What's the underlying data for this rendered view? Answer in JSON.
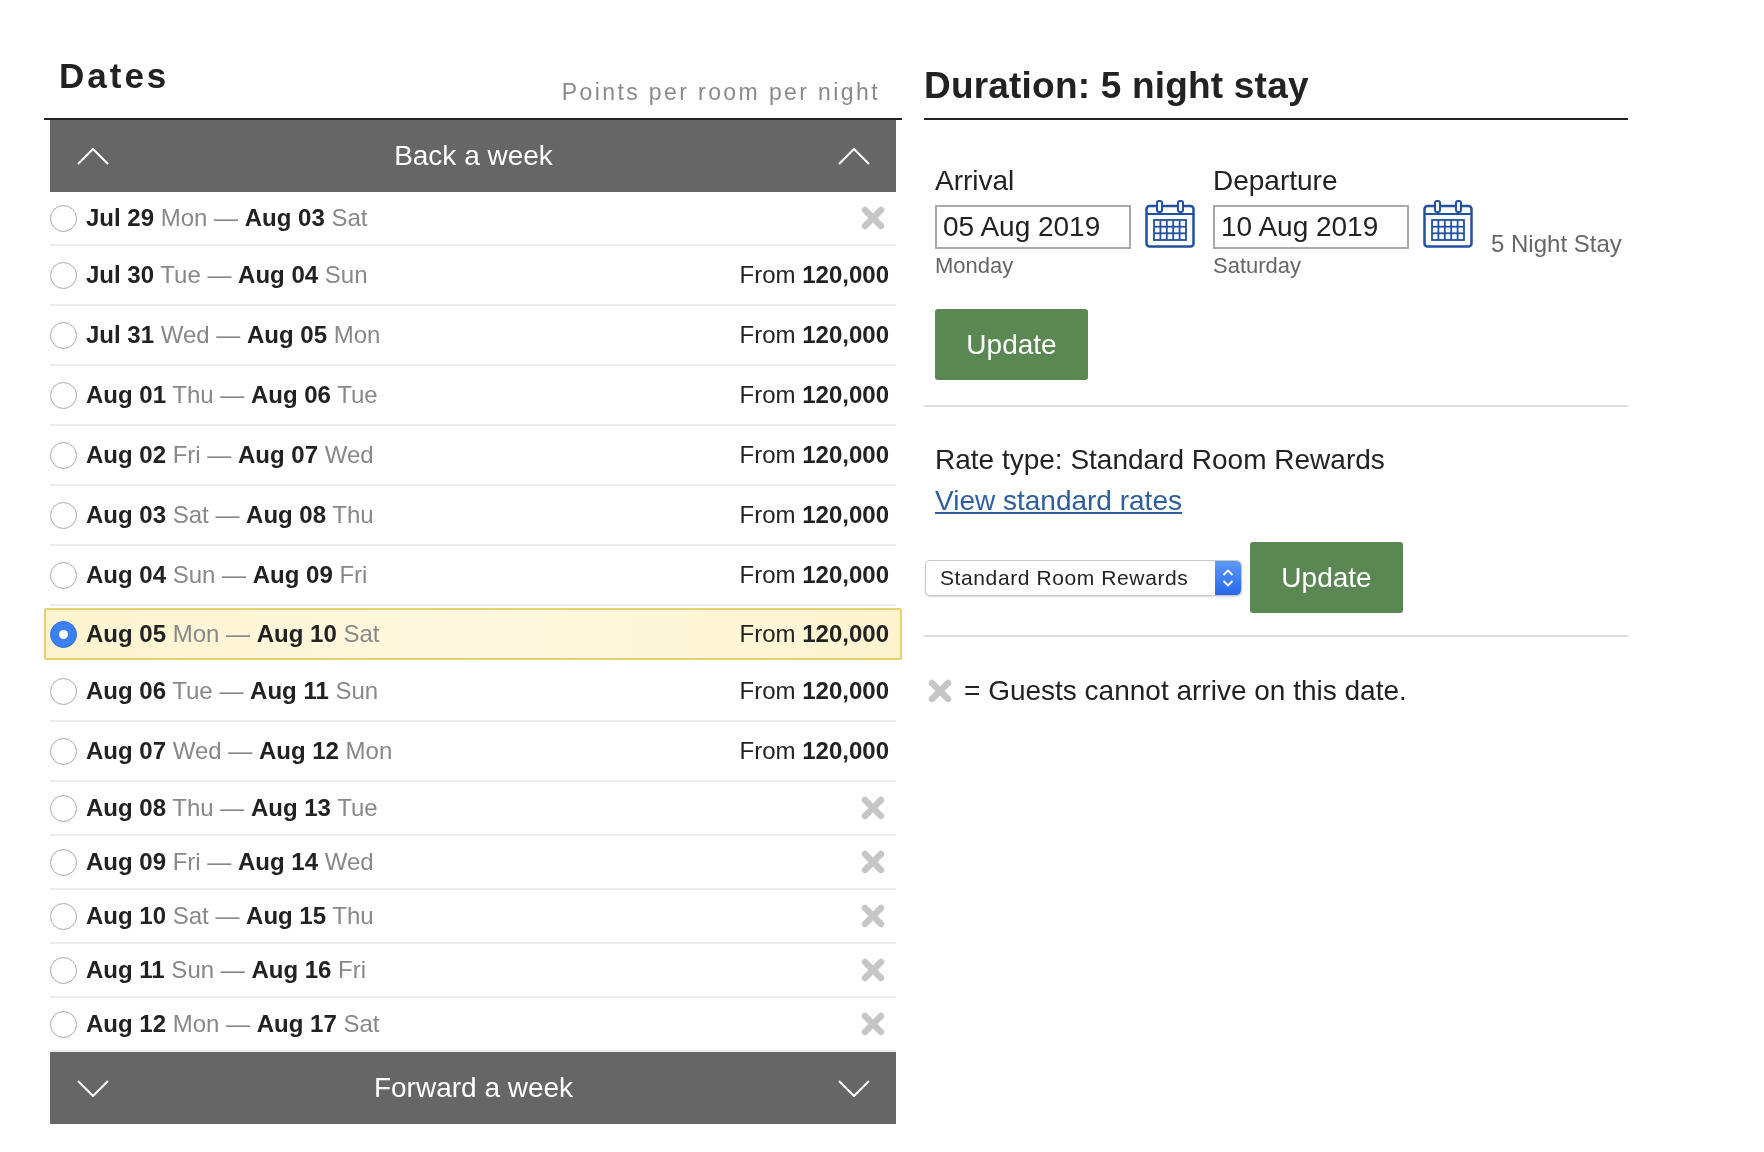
{
  "dates_panel": {
    "title": "Dates",
    "subtitle": "Points per room per night",
    "back_button": {
      "label": "Back a week"
    },
    "rows": [
      {
        "label": "**Jul 29** Mon — **Aug 03** Sat",
        "available": false,
        "selected": false
      },
      {
        "label": "**Jul 30** Tue — **Aug 04** Sun",
        "available": true,
        "price": "From **120,000**",
        "selected": false
      },
      {
        "label": "**Jul 31** Wed — **Aug 05** Mon",
        "available": true,
        "price": "From **120,000**",
        "selected": false
      },
      {
        "label": "**Aug 01** Thu — **Aug 06** Tue",
        "available": true,
        "price": "From **120,000**",
        "selected": false
      },
      {
        "label": "**Aug 02** Fri — **Aug 07** Wed",
        "available": true,
        "price": "From **120,000**",
        "selected": false
      },
      {
        "label": "**Aug 03** Sat — **Aug 08** Thu",
        "available": true,
        "price": "From **120,000**",
        "selected": false
      },
      {
        "label": "**Aug 04** Sun — **Aug 09** Fri",
        "available": true,
        "price": "From **120,000**",
        "selected": false
      },
      {
        "label": "**Aug 05** Mon — **Aug 10** Sat",
        "available": true,
        "price": "From **120,000**",
        "selected": true
      },
      {
        "label": "**Aug 06** Tue — **Aug 11** Sun",
        "available": true,
        "price": "From **120,000**",
        "selected": false
      },
      {
        "label": "**Aug 07** Wed — **Aug 12** Mon",
        "available": true,
        "price": "From **120,000**",
        "selected": false
      },
      {
        "label": "**Aug 08** Thu — **Aug 13** Tue",
        "available": false,
        "selected": false
      },
      {
        "label": "**Aug 09** Fri — **Aug 14** Wed",
        "available": false,
        "selected": false
      },
      {
        "label": "**Aug 10** Sat — **Aug 15** Thu",
        "available": false,
        "selected": false
      },
      {
        "label": "**Aug 11** Sun — **Aug 16** Fri",
        "available": false,
        "selected": false
      },
      {
        "label": "**Aug 12** Mon — **Aug 17** Sat",
        "available": false,
        "selected": false
      }
    ],
    "forward_button": {
      "label": "Forward a week"
    }
  },
  "duration_panel": {
    "title": "Duration: 5 night stay",
    "date_fields": [
      {
        "label": "Arrival",
        "value": "05 Aug 2019",
        "weekday": "Monday"
      },
      {
        "label": "Departure",
        "value": "10 Aug 2019",
        "weekday": "Saturday"
      }
    ],
    "stay_note": "5 Night Stay",
    "update_button": "Update",
    "rate_type": "Rate type: Standard Room Rewards",
    "rates_link": "View standard rates",
    "rate_select": {
      "value": "Standard Room Rewards"
    },
    "rate_update_button": "Update",
    "legend": "= Guests cannot arrive on this date."
  }
}
